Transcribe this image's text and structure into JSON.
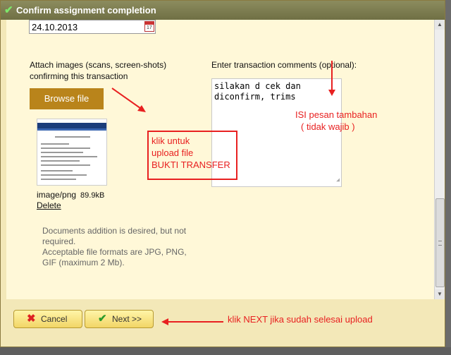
{
  "window": {
    "title": "Confirm assignment completion"
  },
  "date": {
    "value": "24.10.2013",
    "cal_day": "17"
  },
  "attach": {
    "label_line1": "Attach images (scans, screen-shots)",
    "label_line2": "confirming this transaction",
    "browse_label": "Browse file"
  },
  "comments": {
    "label": "Enter transaction comments (optional):",
    "value": "silakan d cek dan\ndiconfirm, trims"
  },
  "file": {
    "type": "image/png",
    "size": "89.9kB",
    "delete_label": "Delete"
  },
  "info": {
    "line1": "Documents addition is desired, but not",
    "line2": "required.",
    "line3": "Acceptable file formats are JPG, PNG,",
    "line4": "GIF (maximum 2 Mb)."
  },
  "annotations": {
    "upload_line1": "klik untuk",
    "upload_line2": "upload file",
    "upload_line3": "BUKTI TRANSFER",
    "comment_line1": "ISI pesan tambahan",
    "comment_line2": "( tidak wajib )",
    "next_hint": "klik NEXT jika sudah selesai upload"
  },
  "buttons": {
    "cancel_label": "Cancel",
    "next_label": "Next >>"
  },
  "colors": {
    "title_bg": "#7d7d52",
    "content_bg": "#fff8d8",
    "browse_bg": "#b9841b",
    "annotation": "#e82020",
    "button_bg": "#f6df7c"
  },
  "icons": {
    "title": "check-icon",
    "cancel": "x-icon",
    "next": "check-icon"
  }
}
